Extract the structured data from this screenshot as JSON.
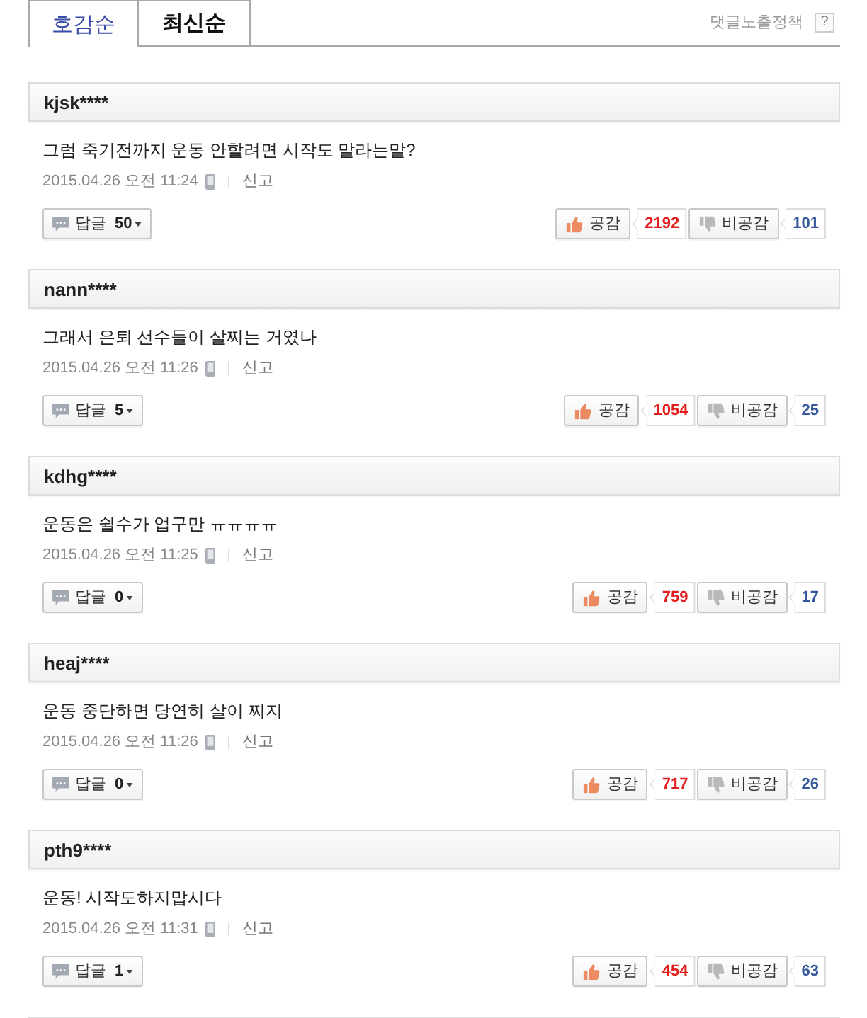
{
  "tabs": [
    {
      "label": "호감순",
      "selected": true
    },
    {
      "label": "최신순",
      "selected": false
    }
  ],
  "policy": {
    "label": "댓글노출정책",
    "help": "?"
  },
  "comments": [
    {
      "user": "kjsk****",
      "text": "그럼 죽기전까지 운동 안할려면 시작도 말라는말?",
      "date": "2015.04.26 오전 11:24",
      "mobile": true,
      "report": "신고",
      "reply_label": "답글",
      "reply_count": "50",
      "like_label": "공감",
      "likes": "2192",
      "dislike_label": "비공감",
      "dislikes": "101"
    },
    {
      "user": "nann****",
      "text": "그래서 은퇴 선수들이 살찌는 거였나",
      "date": "2015.04.26 오전 11:26",
      "mobile": true,
      "report": "신고",
      "reply_label": "답글",
      "reply_count": "5",
      "like_label": "공감",
      "likes": "1054",
      "dislike_label": "비공감",
      "dislikes": "25"
    },
    {
      "user": "kdhg****",
      "text": "운동은 쉴수가 업구만 ㅠㅠㅠㅠ",
      "date": "2015.04.26 오전 11:25",
      "mobile": true,
      "report": "신고",
      "reply_label": "답글",
      "reply_count": "0",
      "like_label": "공감",
      "likes": "759",
      "dislike_label": "비공감",
      "dislikes": "17"
    },
    {
      "user": "heaj****",
      "text": "운동 중단하면 당연히 살이 찌지",
      "date": "2015.04.26 오전 11:26",
      "mobile": true,
      "report": "신고",
      "reply_label": "답글",
      "reply_count": "0",
      "like_label": "공감",
      "likes": "717",
      "dislike_label": "비공감",
      "dislikes": "26"
    },
    {
      "user": "pth9****",
      "text": "운동! 시작도하지맙시다",
      "date": "2015.04.26 오전 11:31",
      "mobile": true,
      "report": "신고",
      "reply_label": "답글",
      "reply_count": "1",
      "like_label": "공감",
      "likes": "454",
      "dislike_label": "비공감",
      "dislikes": "63"
    }
  ]
}
